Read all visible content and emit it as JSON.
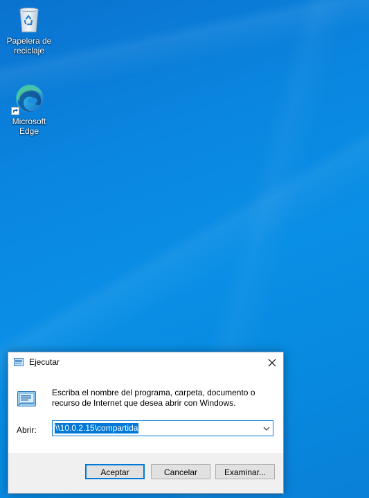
{
  "desktop": {
    "icons": [
      {
        "label_line1": "Papelera de",
        "label_line2": "reciclaje",
        "icon": "recycle-bin-icon"
      },
      {
        "label_line1": "Microsoft Edge",
        "label_line2": "",
        "icon": "edge-icon"
      }
    ]
  },
  "run_dialog": {
    "title": "Ejecutar",
    "description": "Escriba el nombre del programa, carpeta, documento o recurso de Internet que desea abrir con Windows.",
    "open_label": "Abrir:",
    "open_value": "\\\\10.0.2.15\\compartida",
    "buttons": {
      "ok": "Aceptar",
      "cancel": "Cancelar",
      "browse": "Examinar..."
    }
  },
  "colors": {
    "accent": "#0078d7",
    "desktop": "#0a86e0"
  }
}
